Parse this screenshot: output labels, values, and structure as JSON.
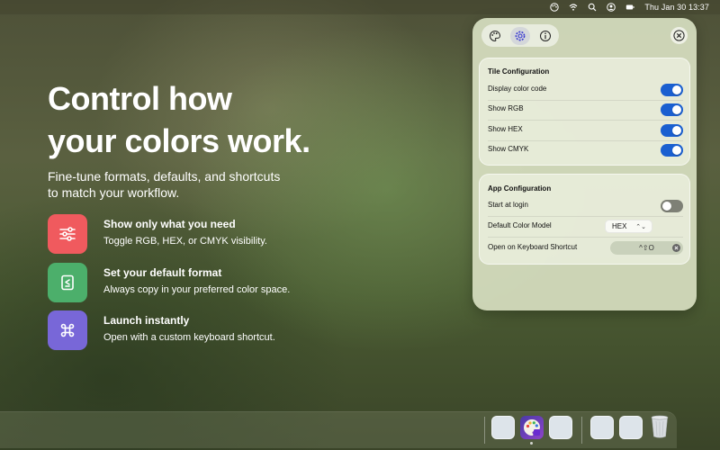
{
  "menubar": {
    "icons": [
      "color-palette-icon",
      "wifi-icon",
      "search-icon",
      "user-circle-icon",
      "battery-icon"
    ],
    "datetime": "Thu Jan 30  13:37"
  },
  "hero": {
    "title_line1": "Control how",
    "title_line2": "your colors work.",
    "subtitle_line1": "Fine-tune formats, defaults, and shortcuts",
    "subtitle_line2": "to match your workflow."
  },
  "features": [
    {
      "icon": "sliders-icon",
      "color": "#f05a5e",
      "title": "Show only what you need",
      "desc": "Toggle RGB, HEX, or CMYK visibility."
    },
    {
      "icon": "document-format-icon",
      "color": "#4caf6b",
      "title": "Set your default format",
      "desc": "Always copy in your preferred color space."
    },
    {
      "icon": "command-key-icon",
      "color": "#7867d8",
      "title": "Launch instantly",
      "desc": "Open with a custom keyboard shortcut."
    }
  ],
  "panel": {
    "tabs": [
      {
        "icon": "palette-icon",
        "active": false
      },
      {
        "icon": "settings-gear-icon",
        "active": true
      },
      {
        "icon": "info-icon",
        "active": false
      }
    ],
    "close_icon": "close-circle-icon",
    "tile_config": {
      "title": "Tile Configuration",
      "rows": [
        {
          "label": "Display color code",
          "on": true
        },
        {
          "label": "Show RGB",
          "on": true
        },
        {
          "label": "Show HEX",
          "on": true
        },
        {
          "label": "Show CMYK",
          "on": true
        }
      ]
    },
    "app_config": {
      "title": "App Configuration",
      "start_at_login_label": "Start at login",
      "start_at_login_on": false,
      "default_model_label": "Default Color Model",
      "default_model_value": "HEX",
      "shortcut_label": "Open on Keyboard Shortcut",
      "shortcut_value": "^⇧O"
    },
    "accent_color": "#1a5fd0"
  },
  "dock": {
    "items": [
      "blank-app-icon",
      "color-picker-app-icon",
      "blank-app-icon",
      "blank-app-icon",
      "blank-app-icon",
      "trash-icon"
    ]
  }
}
